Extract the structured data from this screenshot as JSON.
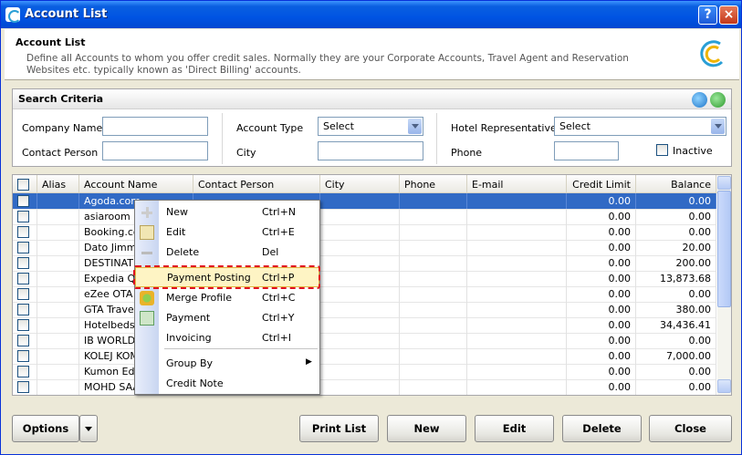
{
  "window": {
    "title": "Account List",
    "help_label": "?",
    "close_label": "×"
  },
  "header": {
    "title": "Account List",
    "description": "Define all Accounts to whom you offer credit sales. Normally they are your Corporate Accounts, Travel Agent and Reservation Websites etc. typically known as 'Direct Billing' accounts."
  },
  "search": {
    "title": "Search Criteria",
    "company_name_label": "Company Name",
    "company_name_value": "",
    "contact_person_label": "Contact Person",
    "contact_person_value": "",
    "account_type_label": "Account Type",
    "account_type_value": "Select",
    "city_label": "City",
    "city_value": "",
    "hotel_rep_label": "Hotel Representative",
    "hotel_rep_value": "Select",
    "phone_label": "Phone",
    "phone_value": "",
    "inactive_label": "Inactive"
  },
  "grid": {
    "columns": [
      "Alias",
      "Account Name",
      "Contact Person",
      "City",
      "Phone",
      "E-mail",
      "Credit Limit",
      "Balance"
    ],
    "rows": [
      {
        "account_name": "Agoda.com",
        "credit_limit": "0.00",
        "balance": "0.00"
      },
      {
        "account_name": "asiaroom",
        "credit_limit": "0.00",
        "balance": "0.00"
      },
      {
        "account_name": "Booking.com",
        "credit_limit": "0.00",
        "balance": "0.00"
      },
      {
        "account_name": "Dato Jimmy",
        "credit_limit": "0.00",
        "balance": "20.00"
      },
      {
        "account_name": "DESTINATI",
        "credit_limit": "0.00",
        "balance": "200.00"
      },
      {
        "account_name": "Expedia Qu",
        "credit_limit": "0.00",
        "balance": "13,873.68"
      },
      {
        "account_name": "eZee OTA E",
        "credit_limit": "0.00",
        "balance": "0.00"
      },
      {
        "account_name": "GTA Travel",
        "credit_limit": "0.00",
        "balance": "380.00"
      },
      {
        "account_name": "Hotelbeds",
        "credit_limit": "0.00",
        "balance": "34,436.41"
      },
      {
        "account_name": "IB WORLD",
        "credit_limit": "0.00",
        "balance": "0.00"
      },
      {
        "account_name": "KOLEJ KOM",
        "credit_limit": "0.00",
        "balance": "7,000.00"
      },
      {
        "account_name": "Kumon Edu",
        "credit_limit": "0.00",
        "balance": "0.00"
      },
      {
        "account_name": "MOHD SAA",
        "credit_limit": "0.00",
        "balance": "0.00"
      }
    ]
  },
  "context_menu": {
    "items": [
      {
        "label": "New",
        "shortcut": "Ctrl+N",
        "icon": "plus-icon"
      },
      {
        "label": "Edit",
        "shortcut": "Ctrl+E",
        "icon": "edit-icon"
      },
      {
        "label": "Delete",
        "shortcut": "Del",
        "icon": "minus-icon"
      },
      {
        "label": "Payment Posting",
        "shortcut": "Ctrl+P",
        "icon": ""
      },
      {
        "label": "Merge Profile",
        "shortcut": "Ctrl+C",
        "icon": "merge-icon"
      },
      {
        "label": "Payment",
        "shortcut": "Ctrl+Y",
        "icon": "payment-icon"
      },
      {
        "label": "Invoicing",
        "shortcut": "Ctrl+I",
        "icon": ""
      },
      {
        "label": "Group By",
        "shortcut": "",
        "icon": ""
      },
      {
        "label": "Credit Note",
        "shortcut": "",
        "icon": ""
      }
    ],
    "submenu_arrow": "▶"
  },
  "buttons": {
    "options": "Options",
    "print_list": "Print List",
    "new": "New",
    "edit": "Edit",
    "delete": "Delete",
    "close": "Close"
  },
  "colors": {
    "title_bar": "#0054e3",
    "selection": "#316ac5",
    "highlight_dash": "#e01020"
  }
}
